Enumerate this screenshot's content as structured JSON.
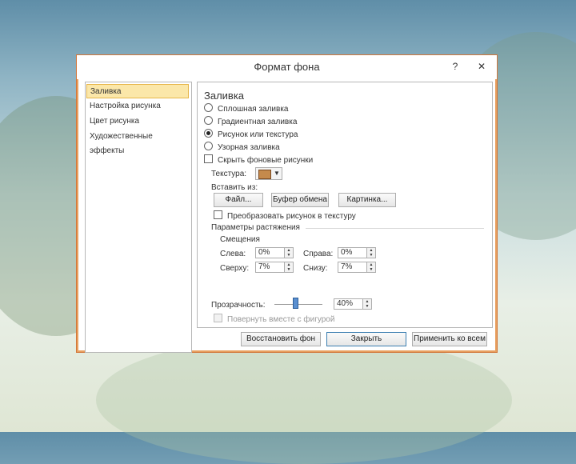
{
  "dialog": {
    "title": "Формат фона",
    "help_label": "?",
    "close_label": "✕"
  },
  "nav": {
    "items": [
      {
        "label": "Заливка",
        "selected": true
      },
      {
        "label": "Настройка рисунка",
        "selected": false
      },
      {
        "label": "Цвет рисунка",
        "selected": false
      },
      {
        "label": "Художественные эффекты",
        "selected": false
      }
    ]
  },
  "fill": {
    "section_title": "Заливка",
    "options": [
      {
        "label": "Сплошная заливка",
        "selected": false
      },
      {
        "label": "Градиентная заливка",
        "selected": false
      },
      {
        "label": "Рисунок или текстура",
        "selected": true
      },
      {
        "label": "Узорная заливка",
        "selected": false
      }
    ],
    "hide_bg_label": "Скрыть фоновые рисунки",
    "texture_label": "Текстура:",
    "insert_from_label": "Вставить из:",
    "file_button": "Файл...",
    "clipboard_button": "Буфер обмена",
    "picture_button": "Картинка...",
    "tile_label": "Преобразовать рисунок в текстуру",
    "stretch_label": "Параметры растяжения",
    "offsets_label": "Смещения",
    "left_label": "Слева:",
    "left_value": "0%",
    "right_label": "Справа:",
    "right_value": "0%",
    "top_label": "Сверху:",
    "top_value": "7%",
    "bottom_label": "Снизу:",
    "bottom_value": "7%",
    "transparency_label": "Прозрачность:",
    "transparency_value": "40%",
    "rotate_label": "Повернуть вместе с фигурой"
  },
  "footer": {
    "reset_button": "Восстановить фон",
    "close_button": "Закрыть",
    "apply_all_button": "Применить ко всем"
  }
}
